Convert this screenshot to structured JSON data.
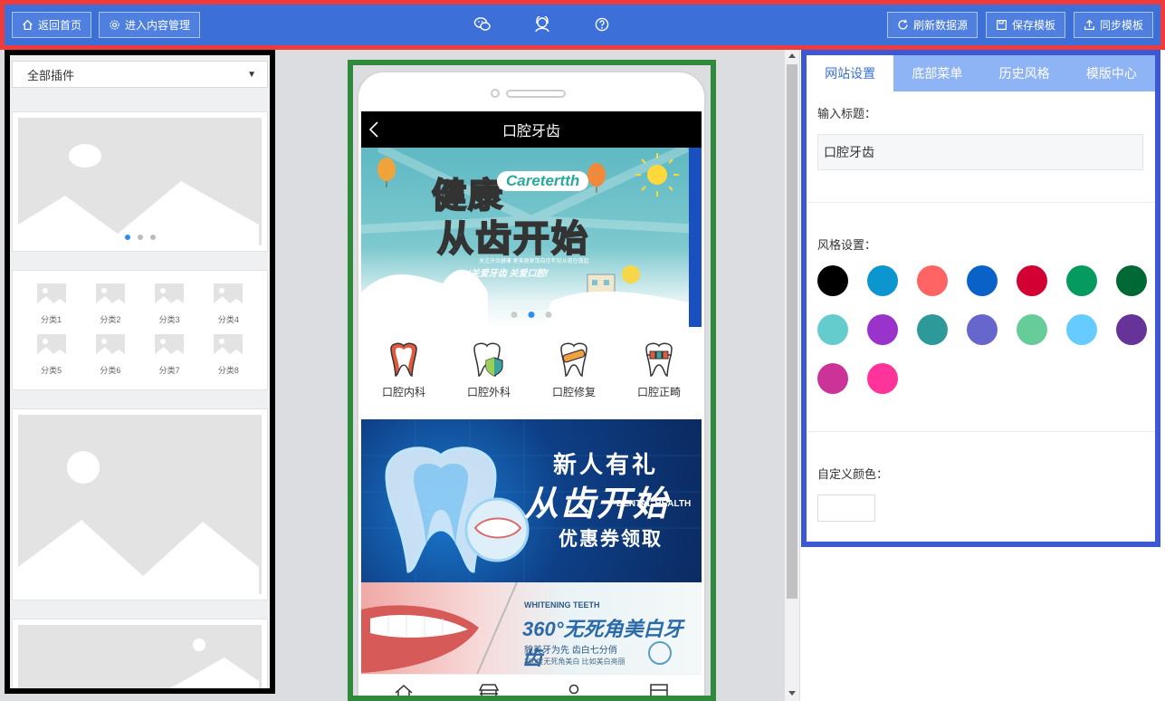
{
  "toolbar": {
    "home_label": "返回首页",
    "content_label": "进入内容管理",
    "refresh_label": "刷新数据源",
    "save_label": "保存模板",
    "sync_label": "同步模板"
  },
  "left": {
    "select_value": "全部插件",
    "categories": [
      "分类1",
      "分类2",
      "分类3",
      "分类4",
      "分类5",
      "分类6",
      "分类7",
      "分类8"
    ]
  },
  "phone": {
    "title": "口腔牙齿",
    "banner1": {
      "line1": "健康",
      "badge": "Caretertth",
      "line2a": "从",
      "line2b": "齿",
      "line2c": "开始",
      "sub_small": "关注牙齿健康 更美丽更加自信年轻从现在做起",
      "sub": "/关爱牙齿 关爱口腔/"
    },
    "categories": [
      "口腔内科",
      "口腔外科",
      "口腔修复",
      "口腔正畸"
    ],
    "banner2": {
      "line1": "新人有礼",
      "line2": "从齿开始",
      "line3": "DENTAL HEALTH",
      "line4": "优惠券领取"
    },
    "banner3": {
      "line1": "WHITENING TEETH",
      "line2": "360°无死角美白牙齿",
      "line3": "貌美牙为先 齿白七分俏",
      "line4": "360度无死角美白 比如美白亮丽"
    }
  },
  "right": {
    "tabs": [
      "网站设置",
      "底部菜单",
      "历史风格",
      "模版中心"
    ],
    "title_label": "输入标题：",
    "title_value": "口腔牙齿",
    "style_label": "风格设置：",
    "swatches": [
      "#000000",
      "#0b96cf",
      "#ff6464",
      "#0a62c9",
      "#d20033",
      "#069b5e",
      "#006835",
      "#64cccc",
      "#9933cc",
      "#2e9999",
      "#6666cc",
      "#66cc99",
      "#66ccff",
      "#663399",
      "#cc3399",
      "#ff3399"
    ],
    "custom_label": "自定义颜色："
  },
  "colors": {
    "frame_red": "#ef3b3b",
    "toolbar_blue": "#3d6fd8",
    "frame_green": "#2f8a3c",
    "frame_blue": "#3c58d4"
  }
}
